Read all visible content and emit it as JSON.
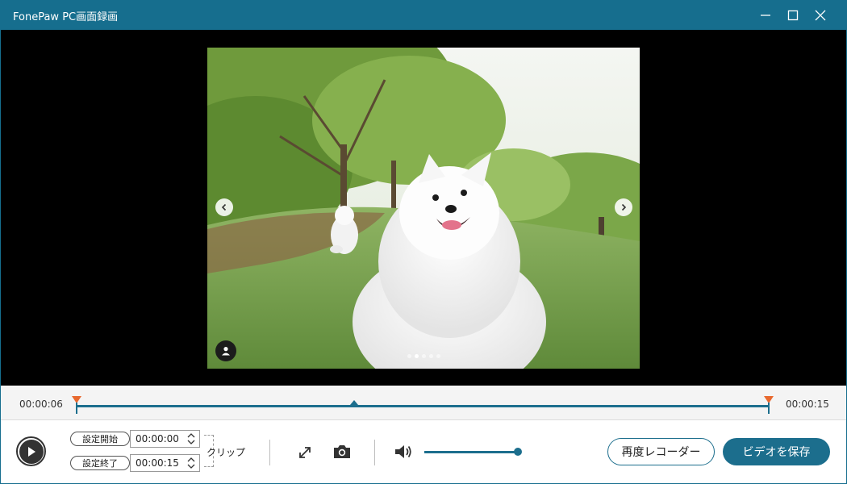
{
  "window": {
    "title": "FonePaw PC画面録画",
    "accent_color": "#166e8e",
    "controls": [
      "minimize-icon",
      "maximize-icon",
      "close-icon"
    ]
  },
  "preview": {
    "carousel_dots": 5,
    "active_dot": 2
  },
  "timeline": {
    "current_time": "00:00:06",
    "total_time": "00:00:15",
    "playhead_fraction": 0.4,
    "marker_color": "#e8692f"
  },
  "clip": {
    "start_label": "設定開始",
    "start_value": "00:00:00",
    "end_label": "設定終了",
    "end_value": "00:00:15",
    "clip_label": "クリップ"
  },
  "volume": {
    "level_fraction": 1.0
  },
  "buttons": {
    "re_record": "再度レコーダー",
    "save_video": "ビデオを保存"
  }
}
